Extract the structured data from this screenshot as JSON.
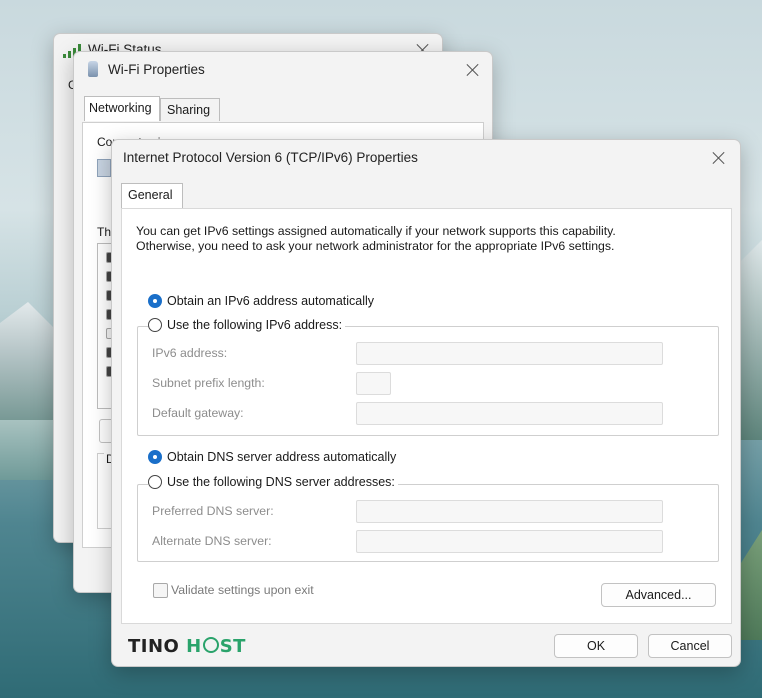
{
  "windows": {
    "status": {
      "title": "Wi-Fi Status",
      "icon": "wifi-signal-icon",
      "partial_label": "G"
    },
    "properties": {
      "title": "Wi-Fi Properties",
      "icon": "network-adapter-icon",
      "tabs": [
        {
          "label": "Networking"
        },
        {
          "label": "Sharing"
        }
      ],
      "partial_text": {
        "connect": "Connect using:",
        "this": "Thi",
        "d": "D"
      }
    },
    "ipv6": {
      "title": "Internet Protocol Version 6 (TCP/IPv6) Properties",
      "tab": "General",
      "intro_line1": "You can get IPv6 settings assigned automatically if your network supports this capability.",
      "intro_line2": "Otherwise, you need to ask your network administrator for the appropriate IPv6 settings.",
      "ip": {
        "auto_label": "Obtain an IPv6 address automatically",
        "auto_selected": true,
        "manual_label": "Use the following IPv6 address:",
        "fields": [
          {
            "label": "IPv6 address:",
            "value": ""
          },
          {
            "label": "Subnet prefix length:",
            "value": ""
          },
          {
            "label": "Default gateway:",
            "value": ""
          }
        ]
      },
      "dns": {
        "auto_label": "Obtain DNS server address automatically",
        "auto_selected": true,
        "manual_label": "Use the following DNS server addresses:",
        "fields": [
          {
            "label": "Preferred DNS server:",
            "value": ""
          },
          {
            "label": "Alternate DNS server:",
            "value": ""
          }
        ]
      },
      "validate_label": "Validate settings upon exit",
      "validate_checked": false,
      "advanced_label": "Advanced...",
      "ok_label": "OK",
      "cancel_label": "Cancel"
    }
  },
  "watermark": {
    "part1": "TINO",
    "part2": "H",
    "part3": "ST"
  },
  "colors": {
    "accent": "#1a6fc9",
    "logo_green": "#2aa36b"
  }
}
